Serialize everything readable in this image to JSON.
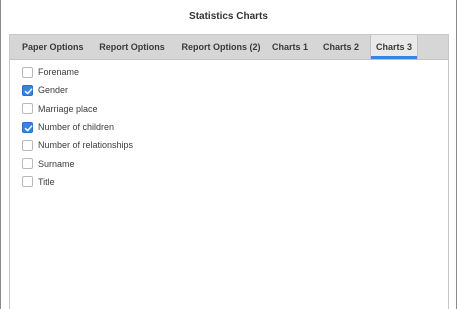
{
  "header": {
    "title": "Statistics Charts"
  },
  "tabs": [
    {
      "label": "Paper Options",
      "active": false
    },
    {
      "label": "Report Options",
      "active": false
    },
    {
      "label": "Report Options (2)",
      "active": false
    },
    {
      "label": "Charts 1",
      "active": false
    },
    {
      "label": "Charts 2",
      "active": false
    },
    {
      "label": "Charts 3",
      "active": true
    }
  ],
  "options": [
    {
      "label": "Forename",
      "checked": false
    },
    {
      "label": "Gender",
      "checked": true
    },
    {
      "label": "Marriage place",
      "checked": false
    },
    {
      "label": "Number of children",
      "checked": true
    },
    {
      "label": "Number of relationships",
      "checked": false
    },
    {
      "label": "Surname",
      "checked": false
    },
    {
      "label": "Title",
      "checked": false
    }
  ],
  "colors": {
    "accent": "#3584e4",
    "tabbar": "#d6d6d6",
    "active_tab": "#e9e9e9"
  }
}
